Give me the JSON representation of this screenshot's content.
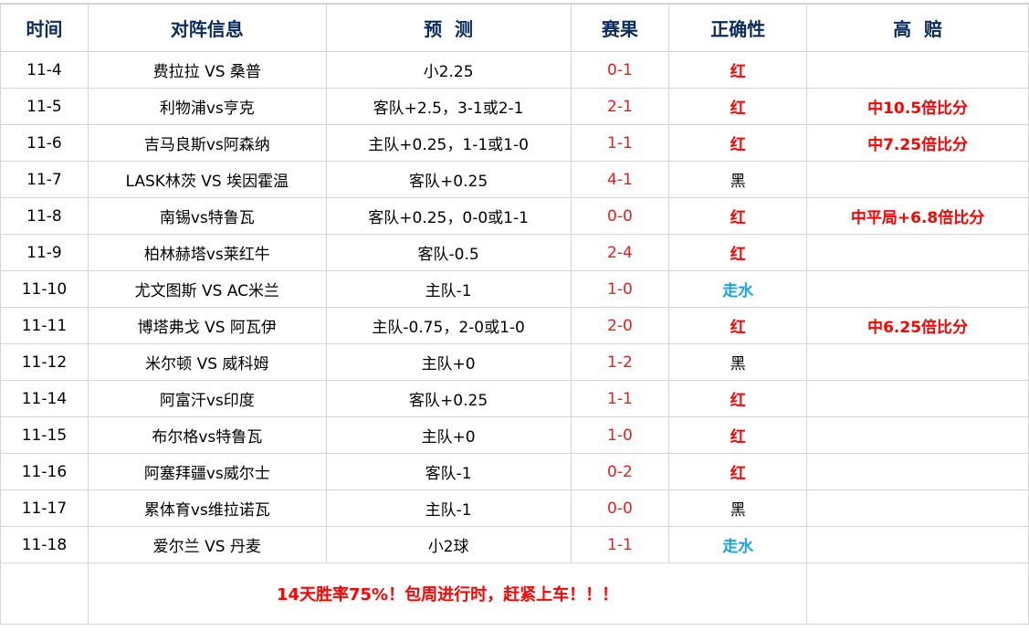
{
  "headers": {
    "date": "时间",
    "match": "对阵信息",
    "prediction": "预  测",
    "score": "赛果",
    "correct": "正确性",
    "high_odds": "高  赔"
  },
  "rows": [
    {
      "date": "11-4",
      "match": "费拉拉 VS 桑普",
      "prediction": "小2.25",
      "score": "0-1",
      "result": "红",
      "result_type": "red",
      "high_odds": ""
    },
    {
      "date": "11-5",
      "match": "利物浦vs亨克",
      "prediction": "客队+2.5，3-1或2-1",
      "score": "2-1",
      "result": "红",
      "result_type": "red",
      "high_odds": "中10.5倍比分"
    },
    {
      "date": "11-6",
      "match": "吉马良斯vs阿森纳",
      "prediction": "主队+0.25，1-1或1-0",
      "score": "1-1",
      "result": "红",
      "result_type": "red",
      "high_odds": "中7.25倍比分"
    },
    {
      "date": "11-7",
      "match": "LASK林茨 VS 埃因霍温",
      "prediction": "客队+0.25",
      "score": "4-1",
      "result": "黑",
      "result_type": "black",
      "high_odds": ""
    },
    {
      "date": "11-8",
      "match": "南锡vs特鲁瓦",
      "prediction": "客队+0.25，0-0或1-1",
      "score": "0-0",
      "result": "红",
      "result_type": "red",
      "high_odds": "中平局+6.8倍比分"
    },
    {
      "date": "11-9",
      "match": "柏林赫塔vs莱红牛",
      "prediction": "客队-0.5",
      "score": "2-4",
      "result": "红",
      "result_type": "red",
      "high_odds": ""
    },
    {
      "date": "11-10",
      "match": "尤文图斯 VS AC米兰",
      "prediction": "主队-1",
      "score": "1-0",
      "result": "走水",
      "result_type": "push",
      "high_odds": ""
    },
    {
      "date": "11-11",
      "match": "博塔弗戈 VS 阿瓦伊",
      "prediction": "主队-0.75，2-0或1-0",
      "score": "2-0",
      "result": "红",
      "result_type": "red",
      "high_odds": "中6.25倍比分"
    },
    {
      "date": "11-12",
      "match": "米尔顿 VS 威科姆",
      "prediction": "主队+0",
      "score": "1-2",
      "result": "黑",
      "result_type": "black",
      "high_odds": ""
    },
    {
      "date": "11-14",
      "match": "阿富汗vs印度",
      "prediction": "客队+0.25",
      "score": "1-1",
      "result": "红",
      "result_type": "red",
      "high_odds": ""
    },
    {
      "date": "11-15",
      "match": "布尔格vs特鲁瓦",
      "prediction": "主队+0",
      "score": "1-0",
      "result": "红",
      "result_type": "red",
      "high_odds": ""
    },
    {
      "date": "11-16",
      "match": "阿塞拜疆vs威尔士",
      "prediction": "客队-1",
      "score": "0-2",
      "result": "红",
      "result_type": "red",
      "high_odds": ""
    },
    {
      "date": "11-17",
      "match": "累体育vs维拉诺瓦",
      "prediction": "主队-1",
      "score": "0-0",
      "result": "黑",
      "result_type": "black",
      "high_odds": ""
    },
    {
      "date": "11-18",
      "match": "爱尔兰 VS 丹麦",
      "prediction": "小2球",
      "score": "1-1",
      "result": "走水",
      "result_type": "push",
      "high_odds": ""
    }
  ],
  "footer": {
    "message": "14天胜率75%！包周进行时，赶紧上车！！！"
  },
  "colors": {
    "header_text": "#0a2b5c",
    "red_result": "#ff0000",
    "push_result": "#1aa3e0",
    "score_text": "#e02020",
    "grid": "#d4d4d4"
  }
}
